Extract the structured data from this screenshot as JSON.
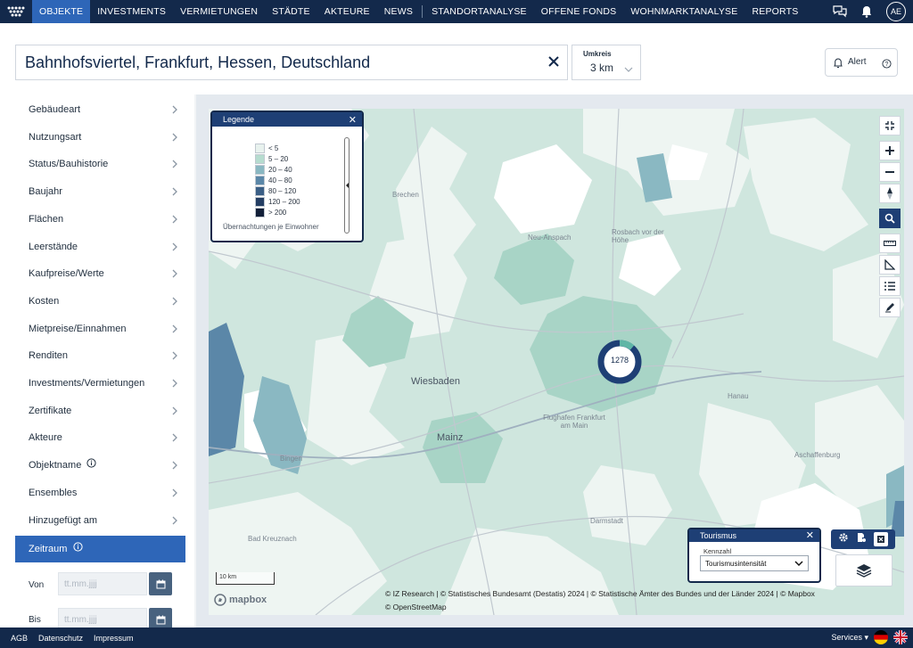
{
  "nav": {
    "items": [
      "OBJEKTE",
      "INVESTMENTS",
      "VERMIETUNGEN",
      "STÄDTE",
      "AKTEURE",
      "NEWS"
    ],
    "items_right": [
      "STANDORTANALYSE",
      "OFFENE FONDS",
      "WOHNMARKTANALYSE",
      "REPORTS"
    ],
    "active": "OBJEKTE",
    "avatar": "AE"
  },
  "search": {
    "value": "Bahnhofsviertel, Frankfurt, Hessen, Deutschland",
    "radius_label": "Umkreis",
    "radius_value": "3 km"
  },
  "alert": {
    "label": "Alert"
  },
  "sidebar": {
    "items": [
      "Gebäudeart",
      "Nutzungsart",
      "Status/Bauhistorie",
      "Baujahr",
      "Flächen",
      "Leerstände",
      "Kaufpreise/Werte",
      "Kosten",
      "Mietpreise/Einnahmen",
      "Renditen",
      "Investments/Vermietungen",
      "Zertifikate",
      "Akteure",
      "Objektname",
      "Ensembles",
      "Hinzugefügt am"
    ],
    "active_item": "Zeitraum",
    "date_from_label": "Von",
    "date_to_label": "Bis",
    "date_placeholder": "tt.mm.jjjj"
  },
  "legend": {
    "title": "Legende",
    "rows": [
      {
        "label": "< 5",
        "color": "#e8f2ee"
      },
      {
        "label": "5 – 20",
        "color": "#b6dccf"
      },
      {
        "label": "20 – 40",
        "color": "#8ab8c2"
      },
      {
        "label": "40 – 80",
        "color": "#5b87a8"
      },
      {
        "label": "80 – 120",
        "color": "#3b5f86"
      },
      {
        "label": "120 – 200",
        "color": "#243e63"
      },
      {
        "label": "> 200",
        "color": "#121f38"
      }
    ],
    "caption": "Übernachtungen je Einwohner"
  },
  "map": {
    "labels": {
      "brechen": "Brechen",
      "neu_anspach": "Neu-Anspach",
      "rosbach": "Rosbach vor der Höhe",
      "hanau": "Hanau",
      "wiesbaden": "Wiesbaden",
      "mainz": "Mainz",
      "flughafen": "Flughafen Frankfurt am Main",
      "bingen": "Bingen",
      "aschaffenburg": "Aschaffenburg",
      "darmstadt": "Darmstadt",
      "bad_kreuznach": "Bad Kreuznach"
    },
    "cluster_count": "1278",
    "scale": "10 km",
    "mapbox": "mapbox",
    "attribution_1": "© IZ Research | © Statistisches Bundesamt (Destatis) 2024 | © Statistische Ämter des Bundes und der Länder 2024 | © Mapbox",
    "attribution_2": "© OpenStreetMap"
  },
  "tourism": {
    "title": "Tourismus",
    "kennzahl_label": "Kennzahl",
    "selected": "Tourismusintensität"
  },
  "footer": {
    "links": [
      "AGB",
      "Datenschutz",
      "Impressum"
    ],
    "services": "Services"
  },
  "colors": {
    "nav_bg": "#13294b",
    "accent": "#2e66b8",
    "panel_head": "#1e3f75"
  }
}
